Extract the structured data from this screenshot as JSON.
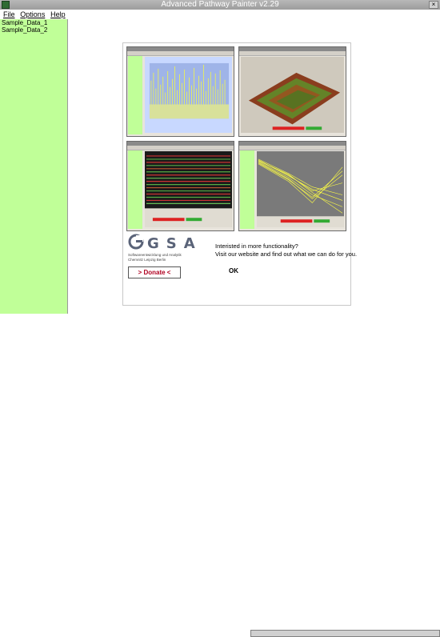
{
  "window": {
    "title": "Advanced Pathway Painter v2.29",
    "close_glyph": "×"
  },
  "menu": {
    "file": "File",
    "options": "Options",
    "help": "Help"
  },
  "sidebar": {
    "items": [
      "Sample_Data_1",
      "Sample_Data_2"
    ]
  },
  "splash": {
    "logo_text": "GSA",
    "logo_subtitle": "Softwareentwicklung und Analytik",
    "logo_subtitle2": "Chemnitz Leipzig Berlin",
    "info_line1": "Interisted in more functionality?",
    "info_line2": "Visit our website and find out what we can do for you.",
    "donate_label": "> Donate <",
    "ok_label": "OK"
  }
}
